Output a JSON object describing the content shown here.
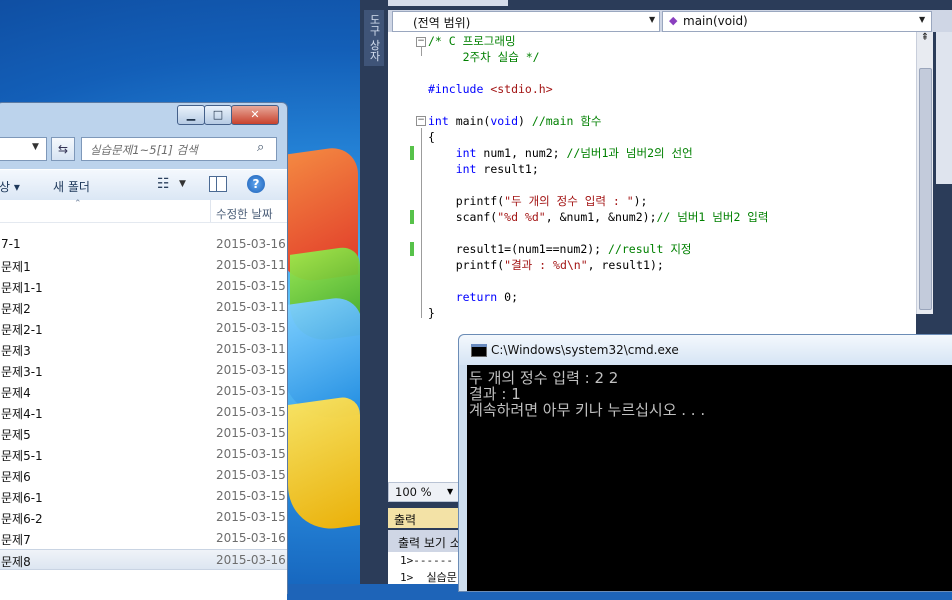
{
  "explorer": {
    "search_placeholder": "실습문제1~5[1] 검색",
    "toolbar": {
      "organize": "상 ▾",
      "new_folder": "새 폴더"
    },
    "columns": {
      "modified": "수정한 날짜"
    },
    "files": [
      {
        "name": "7-1",
        "date": "2015-03-16"
      },
      {
        "name": "문제1",
        "date": "2015-03-11"
      },
      {
        "name": "문제1-1",
        "date": "2015-03-15"
      },
      {
        "name": "문제2",
        "date": "2015-03-11"
      },
      {
        "name": "문제2-1",
        "date": "2015-03-15"
      },
      {
        "name": "문제3",
        "date": "2015-03-11"
      },
      {
        "name": "문제3-1",
        "date": "2015-03-15"
      },
      {
        "name": "문제4",
        "date": "2015-03-15"
      },
      {
        "name": "문제4-1",
        "date": "2015-03-15"
      },
      {
        "name": "문제5",
        "date": "2015-03-15"
      },
      {
        "name": "문제5-1",
        "date": "2015-03-15"
      },
      {
        "name": "문제6",
        "date": "2015-03-15"
      },
      {
        "name": "문제6-1",
        "date": "2015-03-15"
      },
      {
        "name": "문제6-2",
        "date": "2015-03-15"
      },
      {
        "name": "문제7",
        "date": "2015-03-16"
      },
      {
        "name": "문제8",
        "date": "2015-03-16"
      }
    ],
    "selected_file": "문제8"
  },
  "vs": {
    "toolbox_tab": "도구 상자",
    "scope": "(전역 범위)",
    "member": "main(void)",
    "zoom": "100 %",
    "output_title": "출력",
    "output_show": "출력 보기 소",
    "output_lines": [
      "1>------",
      "1>  실습문"
    ],
    "code": {
      "l1_comment": "/* C 프로그래밍",
      "l2_comment": "     2주차 실습 */",
      "l4_pp": "#include",
      "l4_hdr": " <stdio.h>",
      "l6_kw": "int",
      "l6_fn": " main(",
      "l6_void": "void",
      "l6_close": ") ",
      "l6_comment": "//main 함수",
      "l7": "{",
      "l8_kw": "    int",
      "l8_code": " num1, num2; ",
      "l8_comment": "//넘버1과 넘버2의 선언",
      "l9_kw": "    int",
      "l9_code": " result1;",
      "l11_fn": "    printf(",
      "l11_str": "\"두 개의 정수 입력 : \"",
      "l11_end": ");",
      "l12_fn": "    scanf(",
      "l12_str": "\"%d %d\"",
      "l12_code": ", &num1, &num2);",
      "l12_comment": "// 넘버1 넘버2 입력",
      "l14_code": "    result1=(num1==num2); ",
      "l14_comment": "//result 지정",
      "l15_fn": "    printf(",
      "l15_str": "\"결과 : %d\\n\"",
      "l15_end": ", result1);",
      "l17_kw": "    return",
      "l17_end": " 0;",
      "l18": "}"
    }
  },
  "cmd": {
    "title": "C:\\Windows\\system32\\cmd.exe",
    "lines": [
      "두 개의 정수 입력 : 2 2",
      "결과 : 1",
      "계속하려면 아무 키나 누르십시오 . . ."
    ]
  }
}
